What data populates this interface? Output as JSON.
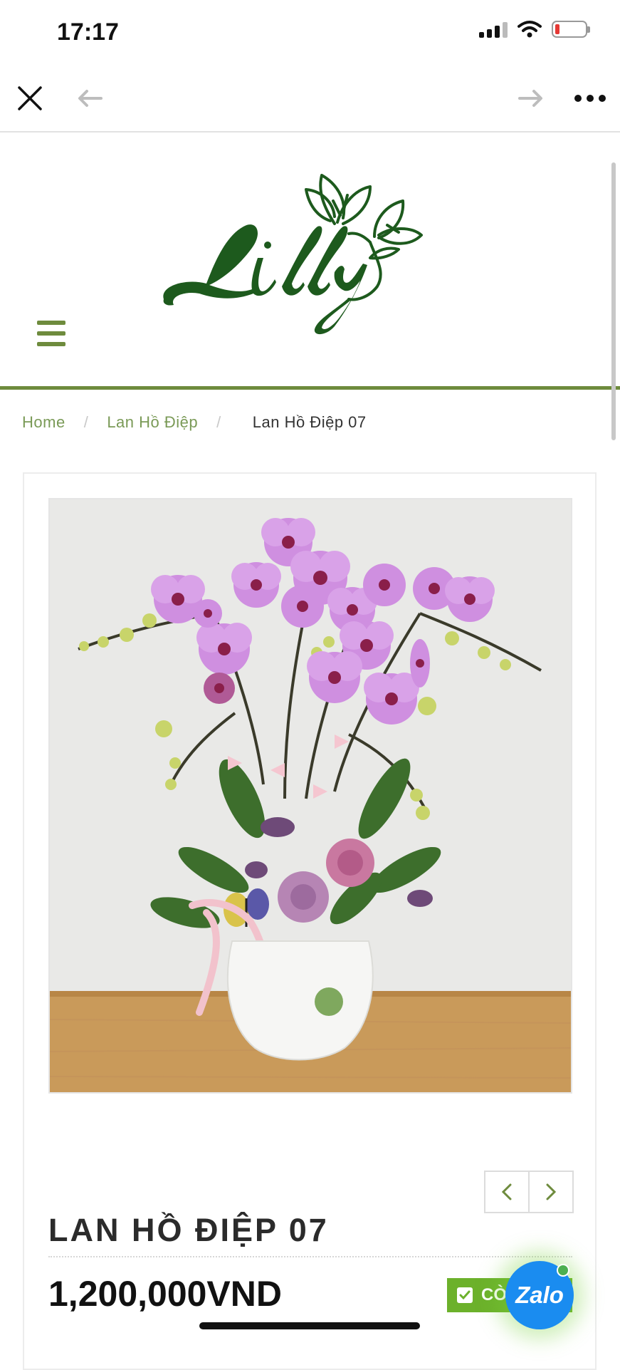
{
  "status_bar": {
    "time": "17:17",
    "icons": [
      "signal-icon",
      "wifi-icon",
      "battery-low-icon"
    ]
  },
  "browser": {
    "icons": [
      "close-icon",
      "back-arrow-icon",
      "forward-arrow-icon",
      "more-icon"
    ]
  },
  "header": {
    "logo_text": "Lilly",
    "menu_icon": "hamburger-menu-icon",
    "accent_color": "#6e8b3d"
  },
  "breadcrumb": {
    "home": "Home",
    "category": "Lan Hồ Điệp",
    "current": "Lan Hồ Điệp 07",
    "separator": "/"
  },
  "product": {
    "title": "LAN HỒ ĐIỆP 07",
    "price": "1,200,000VND",
    "stock_label": "CÒ",
    "stock_color": "#6cb12b"
  },
  "zalo": {
    "label": "Zalo",
    "color": "#1a8cf0"
  }
}
